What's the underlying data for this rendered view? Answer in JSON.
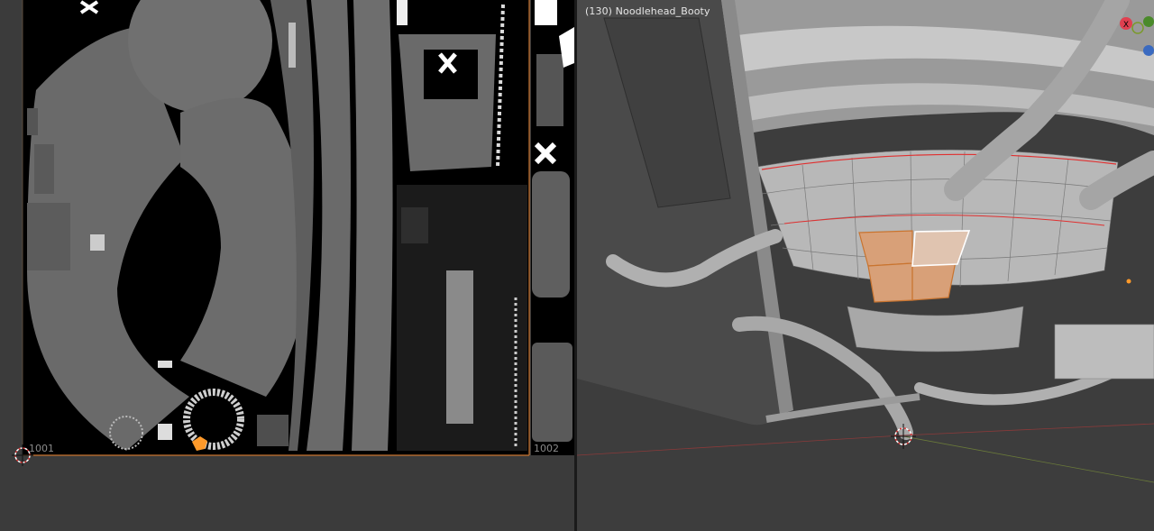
{
  "uv_editor": {
    "tile_1001_label": "1001",
    "tile_1002_label": "1002",
    "colors": {
      "background": "#3b3b3b",
      "tile_fill": "#000000",
      "island_fill": "#6f6f6f",
      "tile_border": "#c9742f",
      "selected_island": "#ff9a2a"
    },
    "icons": [
      "cursor-crosshair-icon"
    ]
  },
  "viewport": {
    "object_label": "(130) Noodlehead_Booty",
    "colors": {
      "background": "#3d3d3d",
      "mesh": "#b5b5b5",
      "seam": "#e03030",
      "selected_face": "#d8a078",
      "active_face_outline": "#ffffff"
    },
    "icons": [
      "3d-cursor-icon",
      "close-x-gizmo-icon",
      "axis-y-gizmo-icon",
      "axis-z-gizmo-icon"
    ],
    "gizmo_x_label": "X"
  }
}
